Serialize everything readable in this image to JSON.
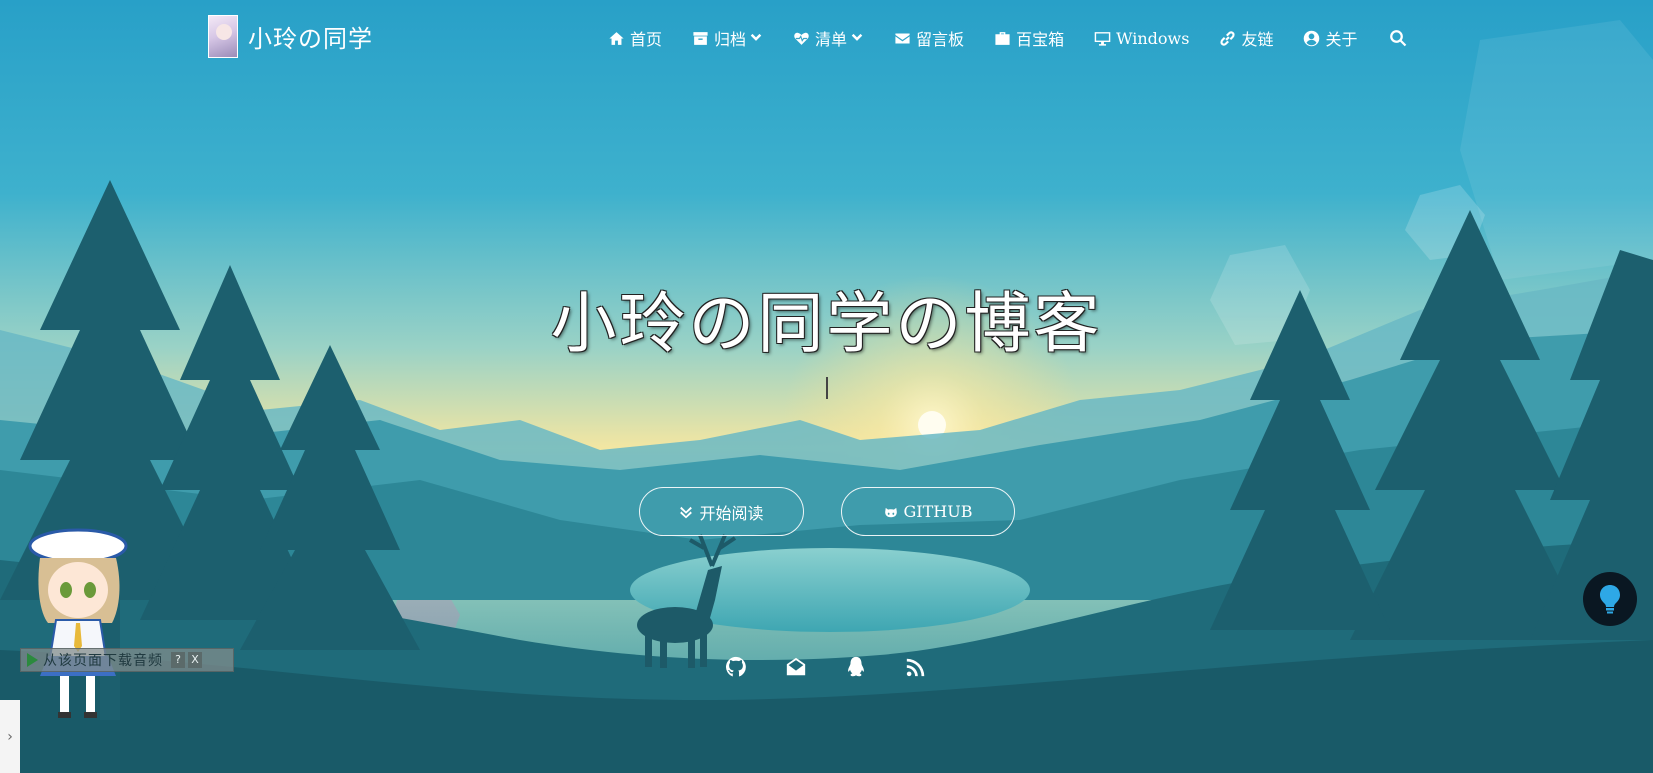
{
  "site": {
    "brand_name": "小玲の同学"
  },
  "nav": {
    "items": [
      {
        "label": "首页",
        "icon": "home-icon"
      },
      {
        "label": "归档",
        "icon": "archive-icon",
        "dropdown": true
      },
      {
        "label": "清单",
        "icon": "heartbeat-icon",
        "dropdown": true
      },
      {
        "label": "留言板",
        "icon": "envelope-icon"
      },
      {
        "label": "百宝箱",
        "icon": "suitcase-icon"
      },
      {
        "label": "Windows",
        "icon": "desktop-icon"
      },
      {
        "label": "友链",
        "icon": "link-icon"
      },
      {
        "label": "关于",
        "icon": "user-circle-icon"
      }
    ],
    "search_icon": "search-icon"
  },
  "hero": {
    "title": "小玲の同学の博客",
    "read_button": "开始阅读",
    "github_button": "GITHUB"
  },
  "socials": [
    "github-icon",
    "mail-icon",
    "qq-icon",
    "rss-icon"
  ],
  "audio_widget": {
    "text": "从该页面下载音频",
    "help": "?",
    "close": "X"
  },
  "colors": {
    "sky_top": "#2ba3c9",
    "sky_mid": "#8fd0c8",
    "sun": "#ffe98a",
    "forest": "#1b5e6d",
    "accent_dark": "#0a1722"
  }
}
